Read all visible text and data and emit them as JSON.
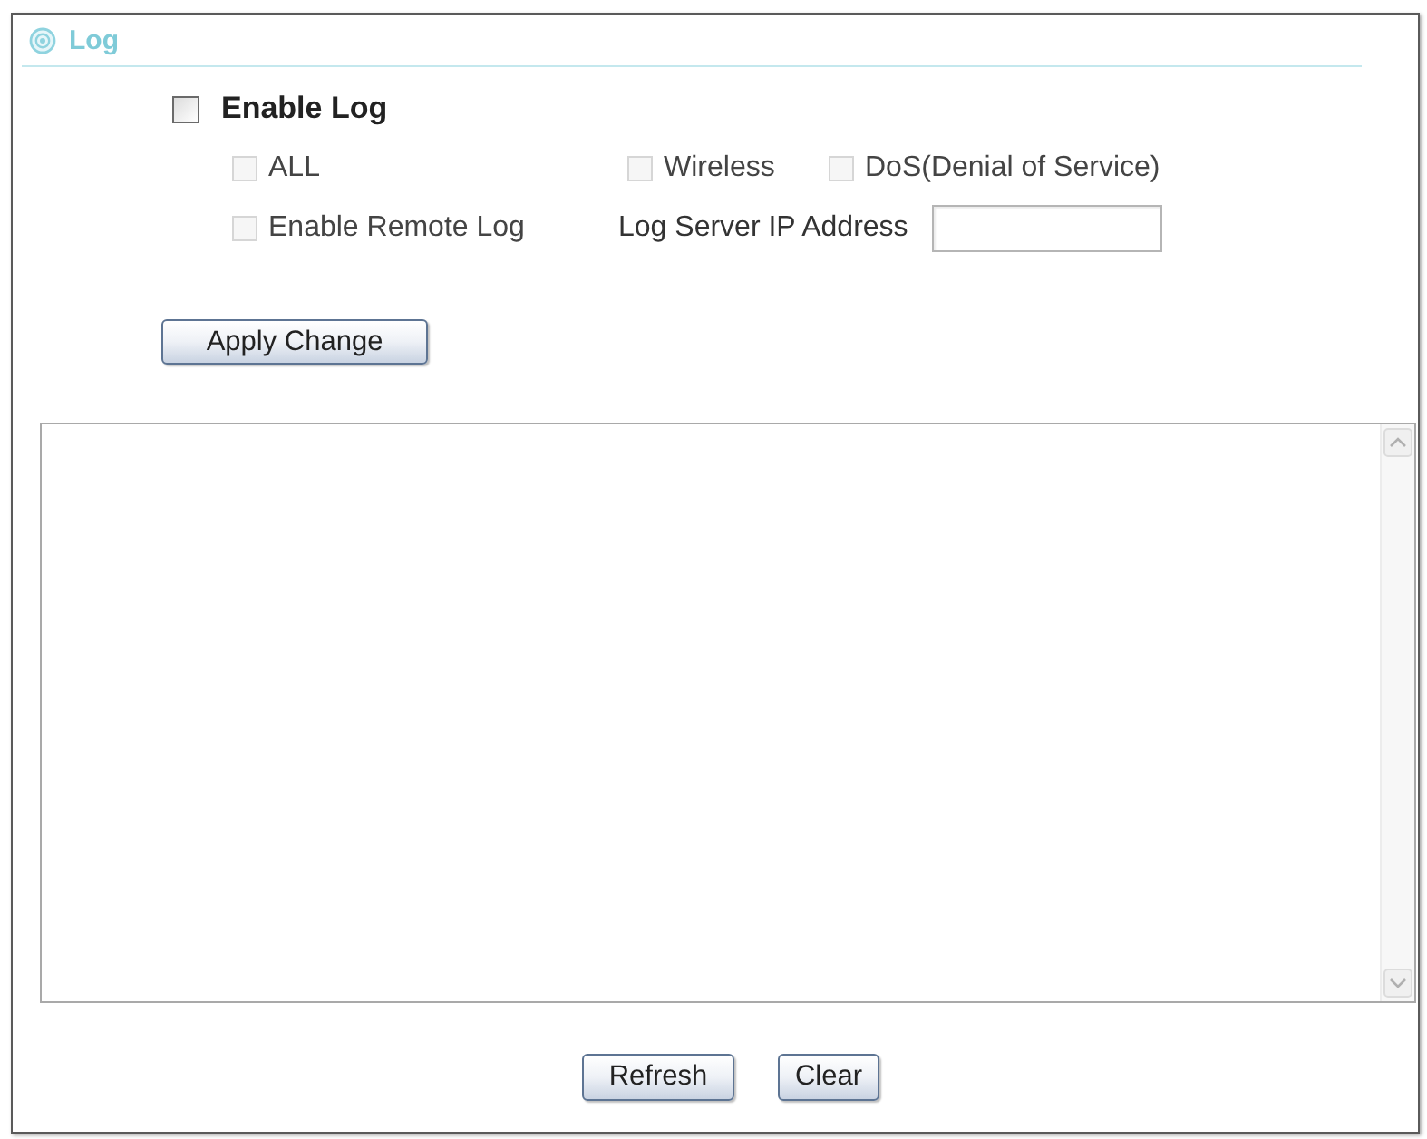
{
  "section": {
    "title": "Log"
  },
  "enable_log": {
    "label": "Enable Log",
    "checked": false,
    "disabled": false
  },
  "options": [
    {
      "label": "ALL",
      "checked": false,
      "disabled": true
    },
    {
      "label": "Wireless",
      "checked": false,
      "disabled": true
    },
    {
      "label": "DoS(Denial of Service)",
      "checked": false,
      "disabled": true
    }
  ],
  "remote_log": {
    "label": "Enable Remote Log",
    "checked": false,
    "disabled": true
  },
  "log_server": {
    "label": "Log Server IP Address"
  },
  "apply_button": {
    "label": "Apply Change"
  },
  "buttons": [
    {
      "label": "Refresh"
    },
    {
      "label": "Clear"
    }
  ]
}
